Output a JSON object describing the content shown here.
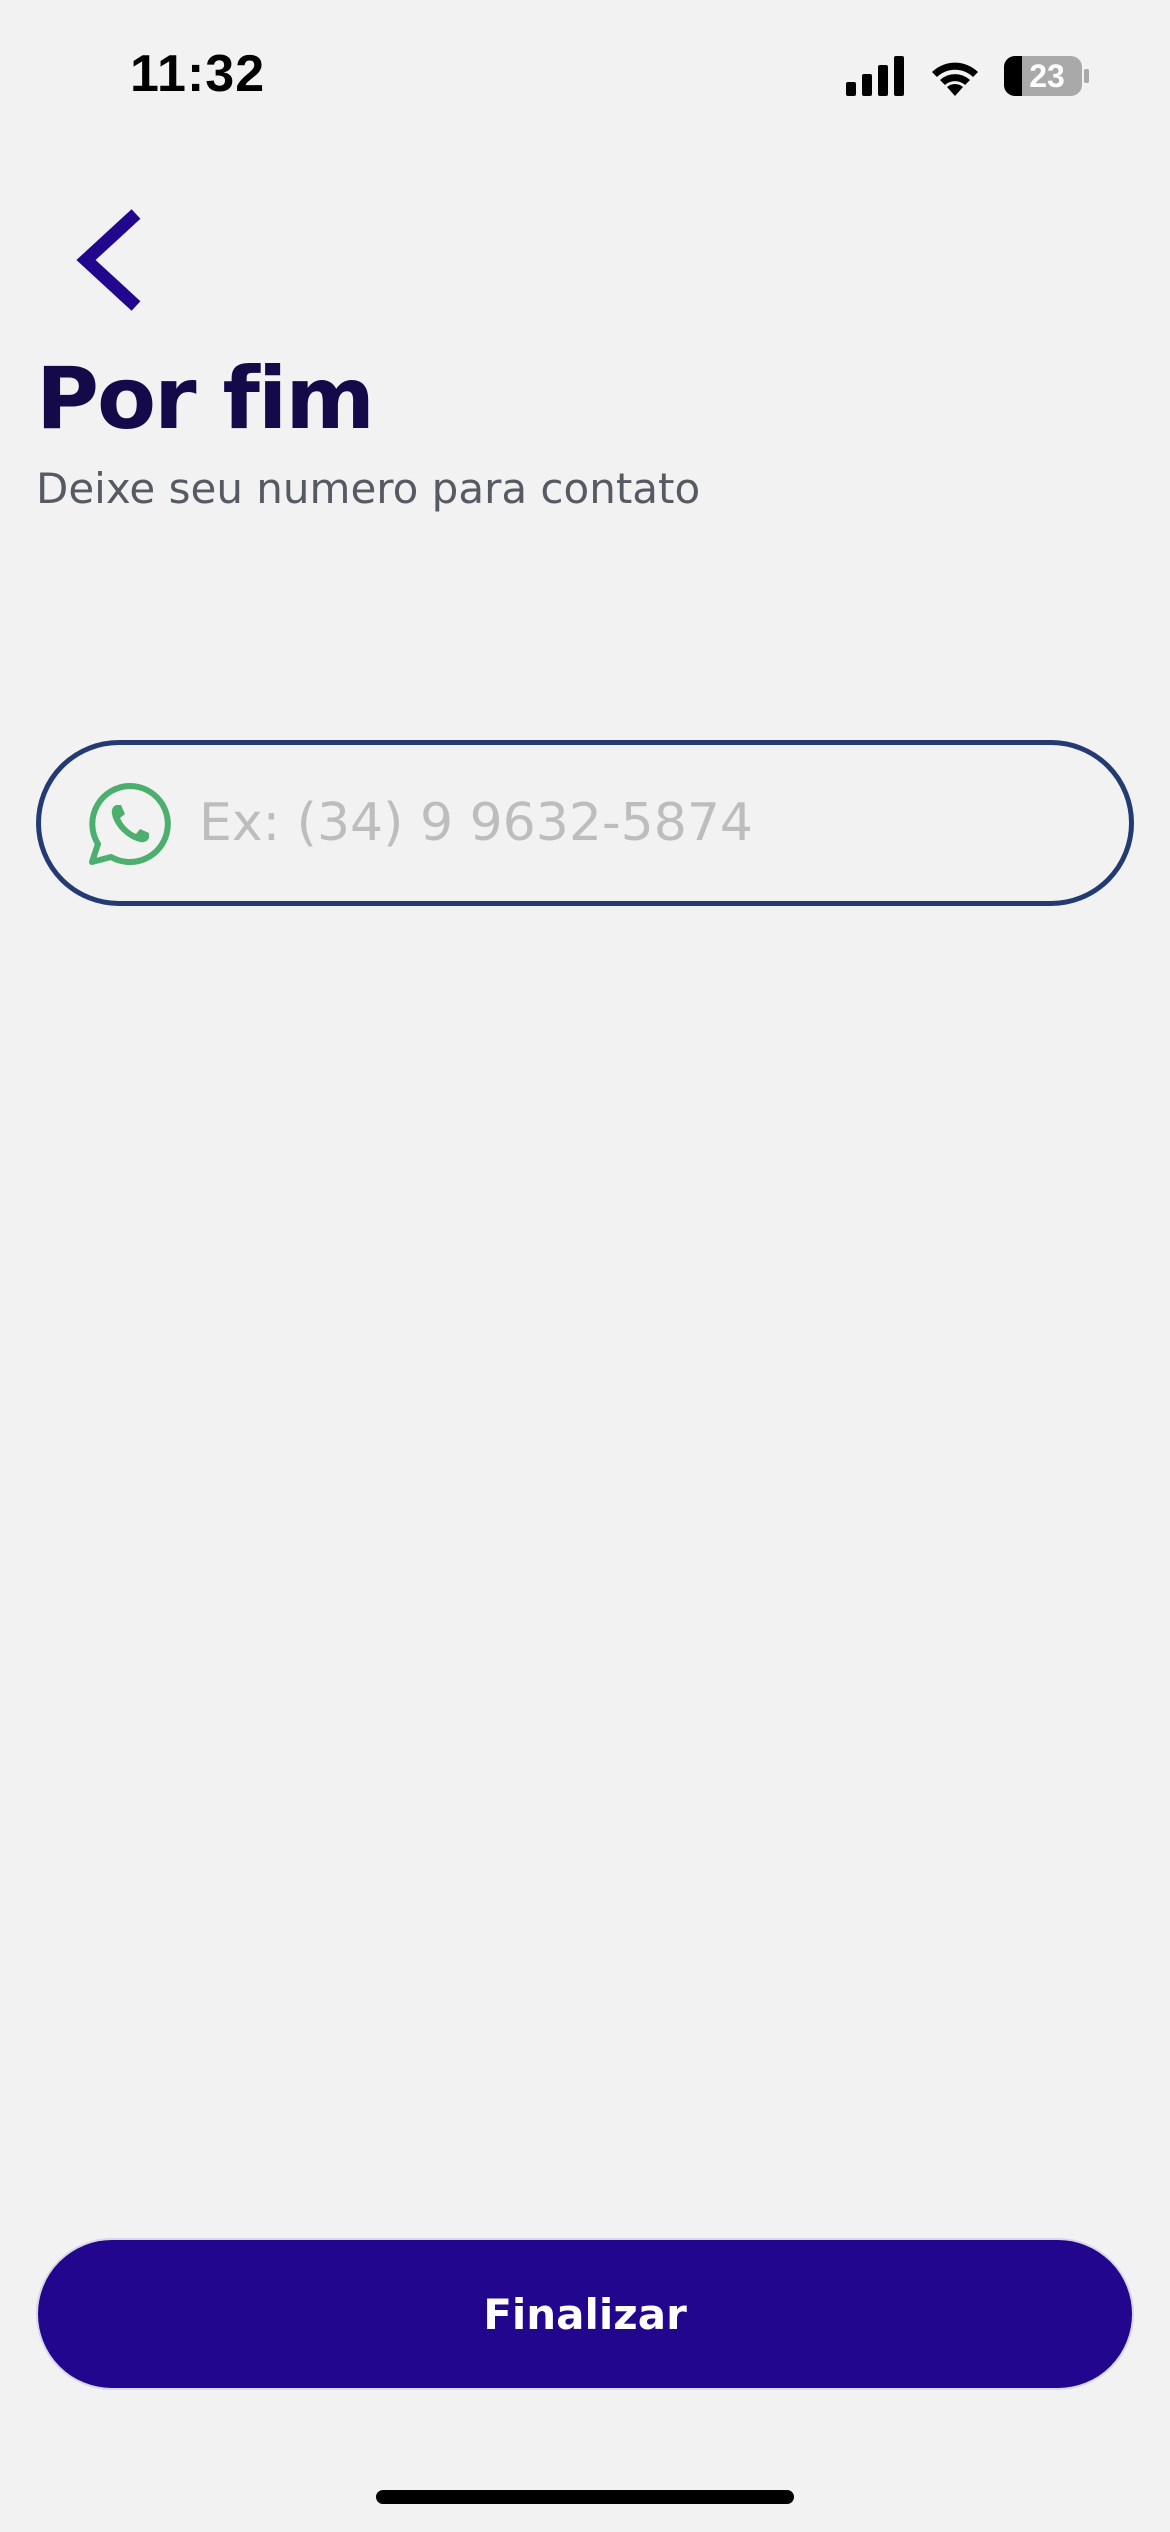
{
  "status_bar": {
    "time": "11:32",
    "battery_level": "23"
  },
  "header": {
    "back_icon": "chevron-left-icon",
    "title": "Por fim",
    "subtitle": "Deixe seu numero para contato"
  },
  "phone": {
    "icon": "whatsapp-icon",
    "placeholder": "Ex: (34) 9 9632-5874",
    "value": ""
  },
  "actions": {
    "finalize_label": "Finalizar"
  },
  "colors": {
    "background": "#f2f2f2",
    "title": "#140a4a",
    "accent": "#22068d",
    "field_border": "#233a72",
    "whatsapp_green": "#4caf6e"
  }
}
